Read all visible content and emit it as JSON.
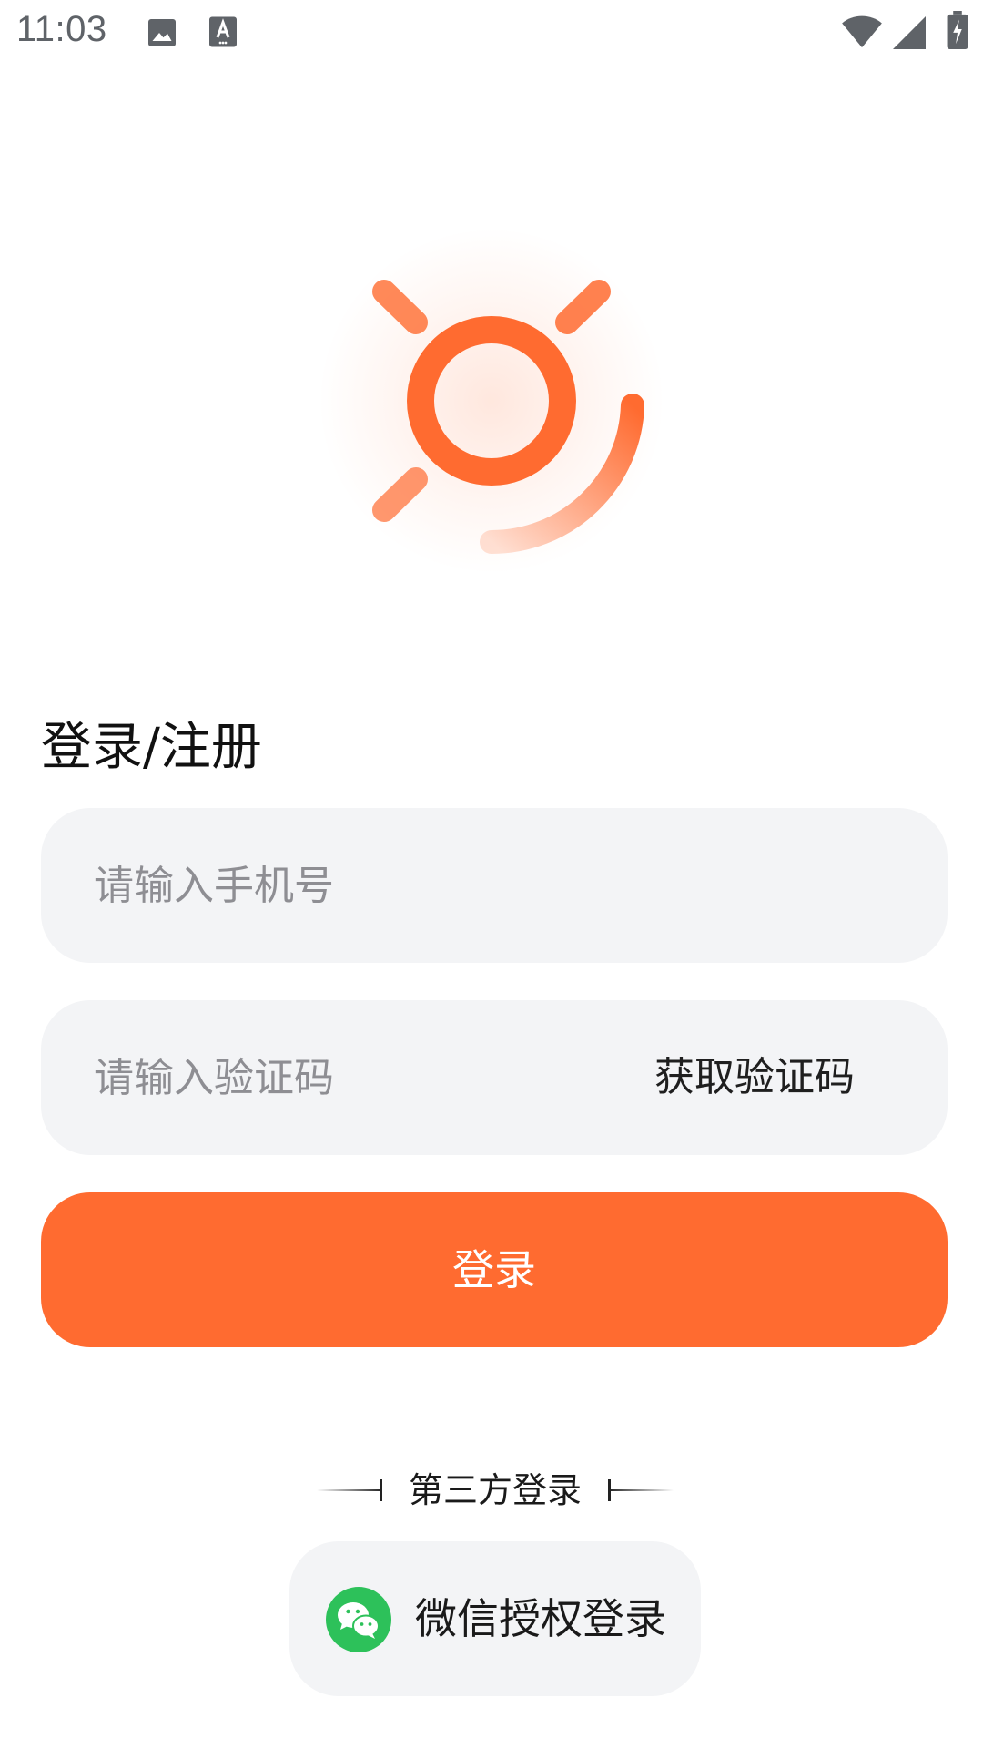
{
  "status_bar": {
    "time": "11:03",
    "icons": [
      "image-icon",
      "a-keyboard-icon",
      "wifi-icon",
      "signal-icon",
      "battery-charging-icon"
    ]
  },
  "app": {
    "logo_icon": "sun-logo-icon",
    "accent_color": "#ff6b30"
  },
  "login": {
    "title": "登录/注册",
    "phone_placeholder": "请输入手机号",
    "phone_value": "",
    "code_placeholder": "请输入验证码",
    "code_value": "",
    "get_code_label": "获取验证码",
    "submit_label": "登录"
  },
  "third_party": {
    "label": "第三方登录",
    "wechat_label": "微信授权登录",
    "wechat_icon": "wechat-icon"
  }
}
